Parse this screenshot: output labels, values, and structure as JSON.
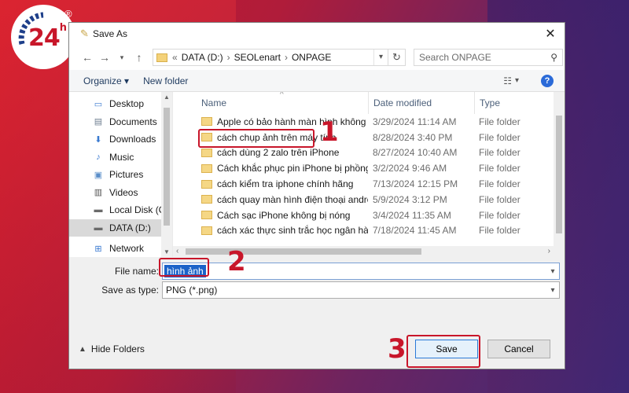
{
  "logo": {
    "text": "24",
    "sup": "h",
    "reg": "®"
  },
  "window": {
    "title": "Save As",
    "close": "✕"
  },
  "address": {
    "prefix": "«",
    "parts": [
      "DATA (D:)",
      "SEOLenart",
      "ONPAGE"
    ],
    "separator": "›",
    "search_placeholder": "Search ONPAGE"
  },
  "toolbar": {
    "organize": "Organize ▾",
    "new_folder": "New folder",
    "help": "?"
  },
  "sidebar": {
    "items": [
      {
        "label": "Desktop",
        "icon": "desktop-icon"
      },
      {
        "label": "Documents",
        "icon": "documents-icon"
      },
      {
        "label": "Downloads",
        "icon": "downloads-icon"
      },
      {
        "label": "Music",
        "icon": "music-icon"
      },
      {
        "label": "Pictures",
        "icon": "pictures-icon"
      },
      {
        "label": "Videos",
        "icon": "videos-icon"
      },
      {
        "label": "Local Disk (C:)",
        "icon": "disk-icon"
      },
      {
        "label": "DATA (D:)",
        "icon": "disk-icon",
        "selected": true
      },
      {
        "label": "Network",
        "icon": "network-icon"
      }
    ]
  },
  "columns": {
    "name": "Name",
    "date": "Date modified",
    "type": "Type"
  },
  "files": [
    {
      "name": "Apple có bảo hành màn hình không",
      "date": "3/29/2024 11:14 AM",
      "type": "File folder"
    },
    {
      "name": "cách chụp ảnh trên máy tính",
      "date": "8/28/2024 3:40 PM",
      "type": "File folder"
    },
    {
      "name": "cách dùng 2 zalo trên iPhone",
      "date": "8/27/2024 10:40 AM",
      "type": "File folder"
    },
    {
      "name": "Cách khắc phục pin iPhone bị phồng",
      "date": "3/2/2024 9:46 AM",
      "type": "File folder"
    },
    {
      "name": "cách kiểm tra iphone chính hãng",
      "date": "7/13/2024 12:15 PM",
      "type": "File folder"
    },
    {
      "name": "cách quay màn hình điện thoại android",
      "date": "5/9/2024 3:12 PM",
      "type": "File folder"
    },
    {
      "name": "Cách sạc iPhone không bị nóng",
      "date": "3/4/2024 11:35 AM",
      "type": "File folder"
    },
    {
      "name": "cách xác thực sinh trắc học ngân hàng",
      "date": "7/18/2024 11:45 AM",
      "type": "File folder"
    }
  ],
  "form": {
    "file_name_label": "File name:",
    "file_name_value": "hình ảnh",
    "save_type_label": "Save as type:",
    "save_type_value": "PNG (*.png)"
  },
  "footer": {
    "hide_folders": "Hide Folders",
    "save": "Save",
    "cancel": "Cancel"
  },
  "annotations": {
    "one": "1",
    "two": "2",
    "three": "3",
    "color": "#c8162a"
  },
  "colors": {
    "accent": "#1b63c9",
    "folder": "#f5d785"
  }
}
